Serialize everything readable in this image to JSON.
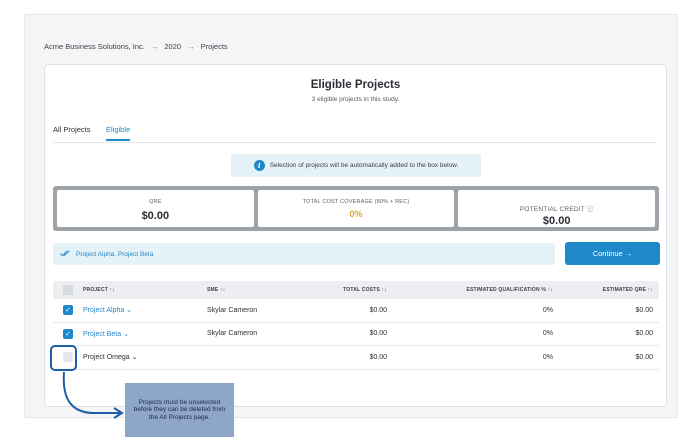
{
  "breadcrumb": {
    "company": "Acme Business Solutions, Inc.",
    "year": "2020",
    "page": "Projects",
    "separator": "→"
  },
  "header": {
    "title": "Eligible Projects",
    "subtitle": "3 eligible projects in this study."
  },
  "tabs": [
    {
      "label": "All Projects",
      "active": false
    },
    {
      "label": "Eligible",
      "active": true
    }
  ],
  "info_banner": {
    "icon": "info-icon",
    "text": "Selection of projects will be automatically added to the box below."
  },
  "stats": {
    "qre_label": "QRE",
    "qre_value": "$0.00",
    "coverage_label": "TOTAL COST COVERAGE (80% + REC)",
    "coverage_value": "0%",
    "credit_label": "POTENTIAL CREDIT ⓘ",
    "credit_value": "$0.00"
  },
  "selection": {
    "icon": "double-check-icon",
    "text": "Project Alpha, Project Beta"
  },
  "continue_label": "Continue →",
  "table": {
    "columns": [
      "PROJECT ↑↓",
      "SME ↑↓",
      "TOTAL COSTS ↑↓",
      "ESTIMATED QUALIFICATION % ↑↓",
      "ESTIMATED QRE ↑↓"
    ],
    "rows": [
      {
        "checked": true,
        "project": "Project Alpha ⌄",
        "sme": "Skylar Cameron",
        "costs": "$0.00",
        "pct": "0%",
        "qre": "$0.00"
      },
      {
        "checked": true,
        "project": "Project Beta ⌄",
        "sme": "Skylar Cameron",
        "costs": "$0.00",
        "pct": "0%",
        "qre": "$0.00"
      },
      {
        "checked": false,
        "project": "Project Omega ⌄",
        "sme": "",
        "costs": "$0.00",
        "pct": "0%",
        "qre": "$0.00"
      }
    ]
  },
  "callout": {
    "text": "Projects must be unselected before they can be deleted from the All Projects page."
  },
  "colors": {
    "accent": "#1e88c9",
    "highlight": "#1f5ea8",
    "callout_bg": "#8fa6cb",
    "warning": "#e0a82e"
  }
}
